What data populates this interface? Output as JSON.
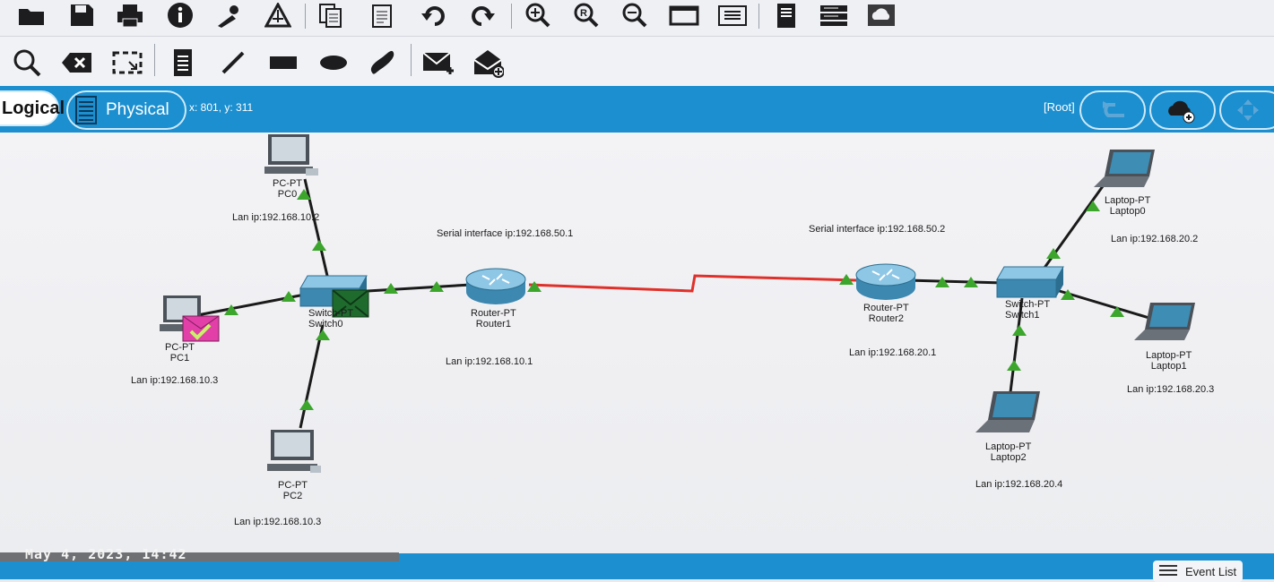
{
  "colors": {
    "accent": "#1b8fcf",
    "link": "#1d1d1f",
    "serial_link": "#e0302a",
    "port_ok": "#3ca52c"
  },
  "toolbar": {
    "main_icons": [
      "open-folder-icon",
      "save-icon",
      "print-icon",
      "info-icon",
      "activity-wizard-icon",
      "network-information-icon",
      "copy-icon",
      "paste-icon",
      "undo-icon",
      "redo-icon",
      "zoom-in-icon",
      "zoom-reset-icon",
      "zoom-out-icon",
      "drawing-palette-icon",
      "custom-device-dialog-icon",
      "ipc-icon",
      "server-icon",
      "cloud-icon"
    ],
    "tool_icons": [
      "inspect-icon",
      "delete-icon",
      "resize-shape-icon",
      "note-icon",
      "line-icon",
      "rectangle-icon",
      "ellipse-icon",
      "freeform-icon",
      "add-simple-pdu-icon",
      "add-complex-pdu-icon"
    ]
  },
  "modebar": {
    "logical_label": "Logical",
    "physical_label": "Physical",
    "coordinates": "x: 801, y: 311",
    "root_label": "[Root]"
  },
  "topology": {
    "annotations": {
      "pc0_ip": "Lan ip:192.168.10.2",
      "pc1_ip": "Lan ip:192.168.10.3",
      "pc2_ip": "Lan ip:192.168.10.3",
      "router1_serial": "Serial interface ip:192.168.50.1",
      "router1_lan": "Lan ip:192.168.10.1",
      "router2_serial": "Serial interface ip:192.168.50.2",
      "router2_lan": "Lan ip:192.168.20.1",
      "laptop0_ip": "Lan ip:192.168.20.2",
      "laptop1_ip": "Lan ip:192.168.20.3",
      "laptop2_ip": "Lan ip:192.168.20.4"
    },
    "devices": {
      "pc0": {
        "type": "PC-PT",
        "name": "PC0"
      },
      "pc1": {
        "type": "PC-PT",
        "name": "PC1"
      },
      "pc2": {
        "type": "PC-PT",
        "name": "PC2"
      },
      "switch0": {
        "type": "Switch-PT",
        "name": "Switch0"
      },
      "router1": {
        "type": "Router-PT",
        "name": "Router1"
      },
      "router2": {
        "type": "Router-PT",
        "name": "Router2"
      },
      "switch1": {
        "type": "Switch-PT",
        "name": "Switch1"
      },
      "laptop0": {
        "type": "Laptop-PT",
        "name": "Laptop0"
      },
      "laptop1": {
        "type": "Laptop-PT",
        "name": "Laptop1"
      },
      "laptop2": {
        "type": "Laptop-PT",
        "name": "Laptop2"
      }
    }
  },
  "status": {
    "timestamp": "May 4, 2023, 14:42",
    "event_list_label": "Event List"
  }
}
